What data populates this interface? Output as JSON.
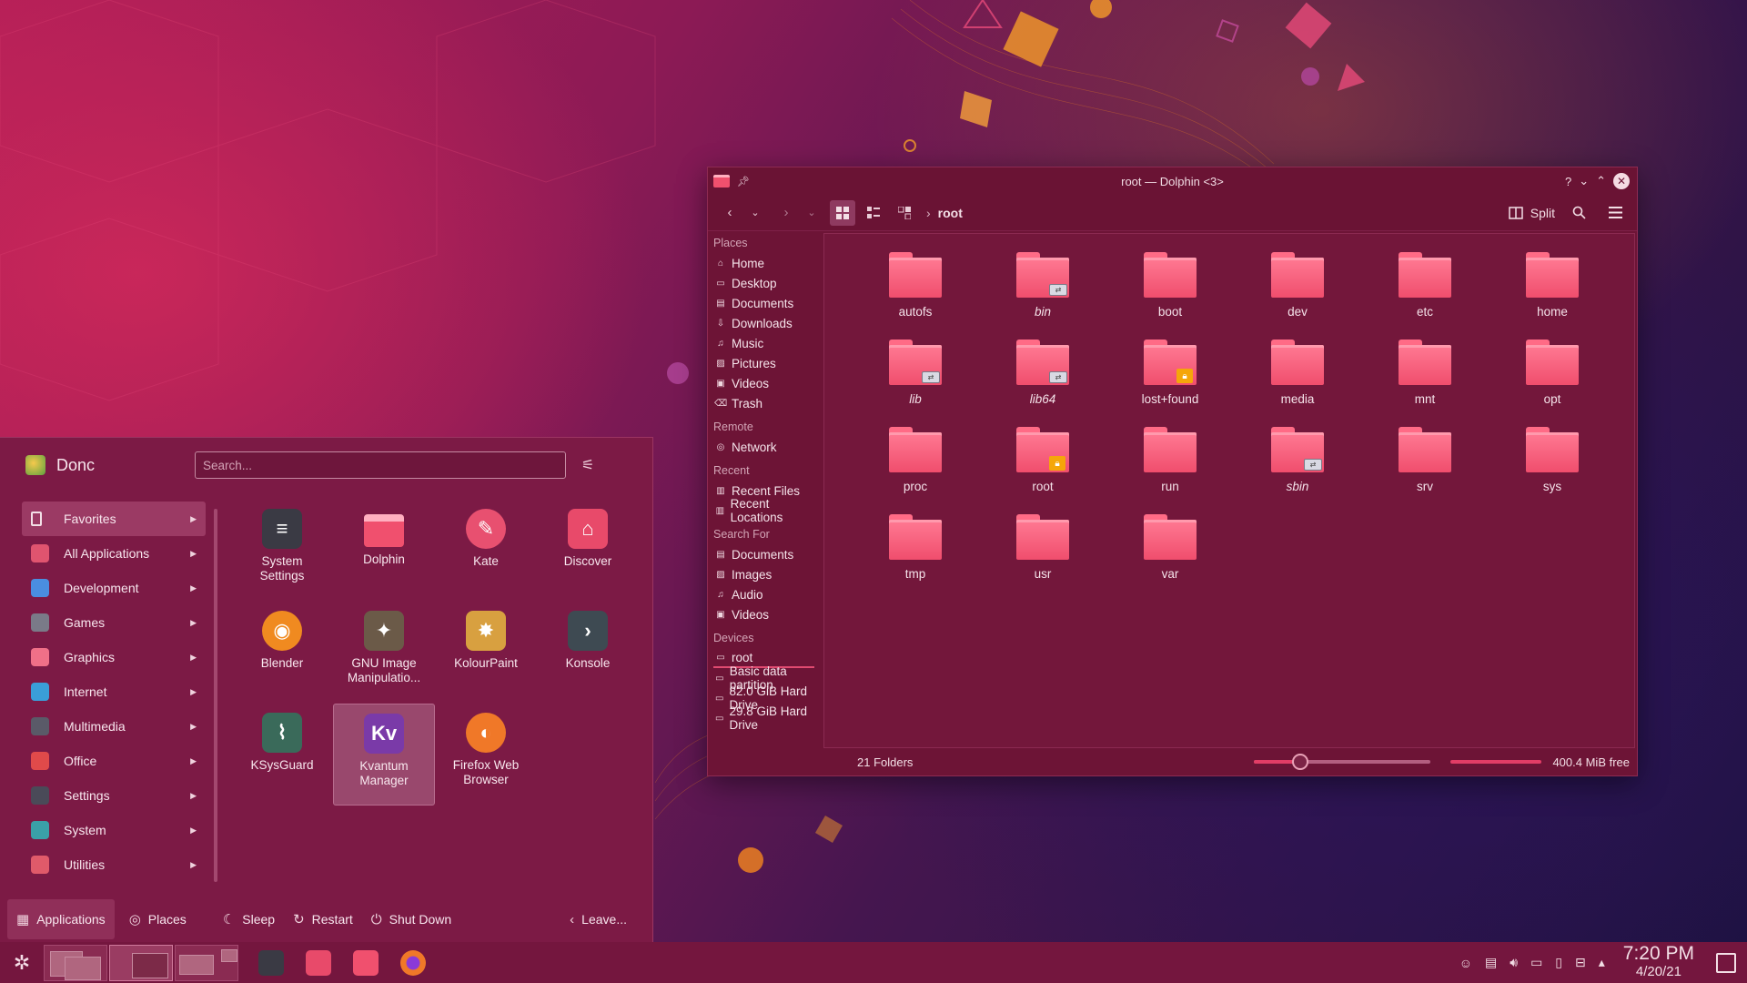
{
  "dolphin": {
    "title": "root — Dolphin <3>",
    "titlebar_buttons": [
      "?",
      "⌄",
      "⌃",
      "✕"
    ],
    "breadcrumb": "root",
    "split_label": "Split",
    "places_groups": [
      {
        "label": "Places",
        "items": [
          {
            "label": "Home",
            "icon": "home-icon"
          },
          {
            "label": "Desktop",
            "icon": "desktop-icon"
          },
          {
            "label": "Documents",
            "icon": "documents-icon"
          },
          {
            "label": "Downloads",
            "icon": "downloads-icon"
          },
          {
            "label": "Music",
            "icon": "music-icon"
          },
          {
            "label": "Pictures",
            "icon": "pictures-icon"
          },
          {
            "label": "Videos",
            "icon": "videos-icon"
          },
          {
            "label": "Trash",
            "icon": "trash-icon"
          }
        ]
      },
      {
        "label": "Remote",
        "items": [
          {
            "label": "Network",
            "icon": "network-icon"
          }
        ]
      },
      {
        "label": "Recent",
        "items": [
          {
            "label": "Recent Files",
            "icon": "recent-files-icon"
          },
          {
            "label": "Recent Locations",
            "icon": "recent-locations-icon"
          }
        ]
      },
      {
        "label": "Search For",
        "items": [
          {
            "label": "Documents",
            "icon": "documents-icon"
          },
          {
            "label": "Images",
            "icon": "images-icon"
          },
          {
            "label": "Audio",
            "icon": "audio-icon"
          },
          {
            "label": "Videos",
            "icon": "videos-icon"
          }
        ]
      },
      {
        "label": "Devices",
        "items": [
          {
            "label": "root",
            "icon": "drive-icon",
            "selected": true
          },
          {
            "label": "Basic data partition",
            "icon": "drive-icon"
          },
          {
            "label": "82.0 GiB Hard Drive",
            "icon": "drive-icon"
          },
          {
            "label": "29.8 GiB Hard Drive",
            "icon": "drive-icon"
          }
        ]
      }
    ],
    "folders": [
      {
        "name": "autofs",
        "emblem": ""
      },
      {
        "name": "bin",
        "emblem": "link",
        "italic": true
      },
      {
        "name": "boot",
        "emblem": ""
      },
      {
        "name": "dev",
        "emblem": ""
      },
      {
        "name": "etc",
        "emblem": ""
      },
      {
        "name": "home",
        "emblem": ""
      },
      {
        "name": "lib",
        "emblem": "link",
        "italic": true
      },
      {
        "name": "lib64",
        "emblem": "link",
        "italic": true
      },
      {
        "name": "lost+found",
        "emblem": "lock"
      },
      {
        "name": "media",
        "emblem": ""
      },
      {
        "name": "mnt",
        "emblem": ""
      },
      {
        "name": "opt",
        "emblem": ""
      },
      {
        "name": "proc",
        "emblem": ""
      },
      {
        "name": "root",
        "emblem": "lock"
      },
      {
        "name": "run",
        "emblem": ""
      },
      {
        "name": "sbin",
        "emblem": "link",
        "italic": true
      },
      {
        "name": "srv",
        "emblem": ""
      },
      {
        "name": "sys",
        "emblem": ""
      },
      {
        "name": "tmp",
        "emblem": ""
      },
      {
        "name": "usr",
        "emblem": ""
      },
      {
        "name": "var",
        "emblem": ""
      }
    ],
    "status": {
      "count": "21 Folders",
      "free": "400.4 MiB free",
      "zoom_fraction": 0.26
    }
  },
  "launcher": {
    "username": "Donc",
    "search_placeholder": "Search...",
    "categories": [
      {
        "label": "Favorites",
        "color": "#9b3a64",
        "selected": true
      },
      {
        "label": "All Applications",
        "color": "#e0546f"
      },
      {
        "label": "Development",
        "color": "#4a8ee0"
      },
      {
        "label": "Games",
        "color": "#7a7a88"
      },
      {
        "label": "Graphics",
        "color": "#f07088"
      },
      {
        "label": "Internet",
        "color": "#3a9ed8"
      },
      {
        "label": "Multimedia",
        "color": "#5a5a68"
      },
      {
        "label": "Office",
        "color": "#e04a4a"
      },
      {
        "label": "Settings",
        "color": "#4a4a58"
      },
      {
        "label": "System",
        "color": "#3aa0a8"
      },
      {
        "label": "Utilities",
        "color": "#e05a6a"
      }
    ],
    "apps": [
      {
        "name": "System\nSettings",
        "icon": "system-settings-icon",
        "color": "#3a3a44",
        "glyph": "≡"
      },
      {
        "name": "Dolphin",
        "icon": "dolphin-icon",
        "color": "#f0506e",
        "glyph": ""
      },
      {
        "name": "Kate",
        "icon": "kate-icon",
        "color": "#e85070",
        "glyph": "✎"
      },
      {
        "name": "Discover",
        "icon": "discover-icon",
        "color": "#e84a6a",
        "glyph": "⌂"
      },
      {
        "name": "Blender",
        "icon": "blender-icon",
        "color": "#f08a20",
        "glyph": "◉"
      },
      {
        "name": "GNU Image\nManipulatio...",
        "icon": "gimp-icon",
        "color": "#6b5a48",
        "glyph": "✦"
      },
      {
        "name": "KolourPaint",
        "icon": "kolourpaint-icon",
        "color": "#d8a040",
        "glyph": "✸"
      },
      {
        "name": "Konsole",
        "icon": "konsole-icon",
        "color": "#3e4a52",
        "glyph": "›"
      },
      {
        "name": "KSysGuard",
        "icon": "ksysguard-icon",
        "color": "#3a6a5a",
        "glyph": "⌇"
      },
      {
        "name": "Kvantum\nManager",
        "icon": "kvantum-icon",
        "color": "#7a3aa8",
        "glyph": "Kv",
        "hover": true
      },
      {
        "name": "Firefox Web\nBrowser",
        "icon": "firefox-icon",
        "color": "#f07828",
        "glyph": "◐"
      }
    ],
    "footer": {
      "applications": "Applications",
      "places": "Places",
      "sleep": "Sleep",
      "restart": "Restart",
      "shutdown": "Shut Down",
      "leave": "Leave..."
    }
  },
  "taskbar": {
    "time": "7:20 PM",
    "date": "4/20/21",
    "tasks": [
      {
        "name": "system-settings-task",
        "color": "#3a3a44"
      },
      {
        "name": "discover-task",
        "color": "#e84a6a"
      },
      {
        "name": "dolphin-task",
        "color": "#f0506e"
      },
      {
        "name": "firefox-task",
        "color": "#f07828"
      }
    ]
  },
  "colors": {
    "accent": "#e23d66",
    "window_bg": "#6d1436",
    "folder": "#f04e6d"
  }
}
